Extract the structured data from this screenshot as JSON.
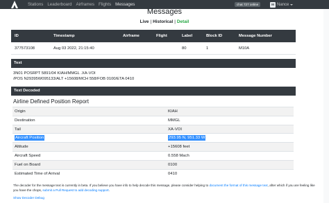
{
  "nav": {
    "logo_icon": "airframes-logo-icon",
    "links": [
      "Stations",
      "Leaderboard",
      "Airframes",
      "Flights",
      "Messages"
    ],
    "chat_badge": "chat  727 online",
    "avatar_initial": "M",
    "user_name": "Nance"
  },
  "page": {
    "title": "Messages",
    "view_live": "Live",
    "view_historical": "Historical",
    "view_detail": "Detail",
    "separator": "|"
  },
  "message_table": {
    "headers": [
      "ID",
      "Timestamp",
      "Airframe",
      "Flight",
      "Label",
      "Block ID",
      "Message Number"
    ],
    "row": [
      "377573108",
      "Aug 03 2022, 21:15:40",
      "",
      "",
      "80",
      "1",
      "M10A"
    ]
  },
  "text_section": {
    "title": "Text",
    "lines": [
      "3N01 POSRPT 5891/04 KIAH/MMGL .XA-VOI",
      "/POS N29395W095133/ALT +15608/MCH 558/FOB 0100/ETA 0410"
    ]
  },
  "decoded_section": {
    "title": "Text Decoded",
    "subtitle": "Airline Defined Position Report",
    "rows": [
      {
        "key": "Origin",
        "value": "KIAH"
      },
      {
        "key": "Destination",
        "value": "MMGL"
      },
      {
        "key": "Tail",
        "value": "XA-VOI"
      },
      {
        "key": "Aircraft Position",
        "value": "293.95 N, 951.33 W"
      },
      {
        "key": "Altitude",
        "value": "+15608 feet"
      },
      {
        "key": "Aircraft Speed",
        "value": "0.558 Mach"
      },
      {
        "key": "Fuel on Board",
        "value": "0100"
      },
      {
        "key": "Estimated Time of Arrival",
        "value": "0410"
      }
    ]
  },
  "footnote": {
    "part1": "The decoder for the message text is currently in beta. If you believe you have info to help decode this message, please consider helping to ",
    "link1": "document the format of this message text",
    "part2": ", after which if you are feeling like you have the chops, ",
    "link2": "submit a Pull Request to add decoding support",
    "part3": "."
  },
  "debug_link": "Show Decoder Debug",
  "colors": {
    "navbar": "#343a40",
    "accent_green": "#28a745",
    "link_blue": "#007bff",
    "selection": "#3390ff"
  }
}
